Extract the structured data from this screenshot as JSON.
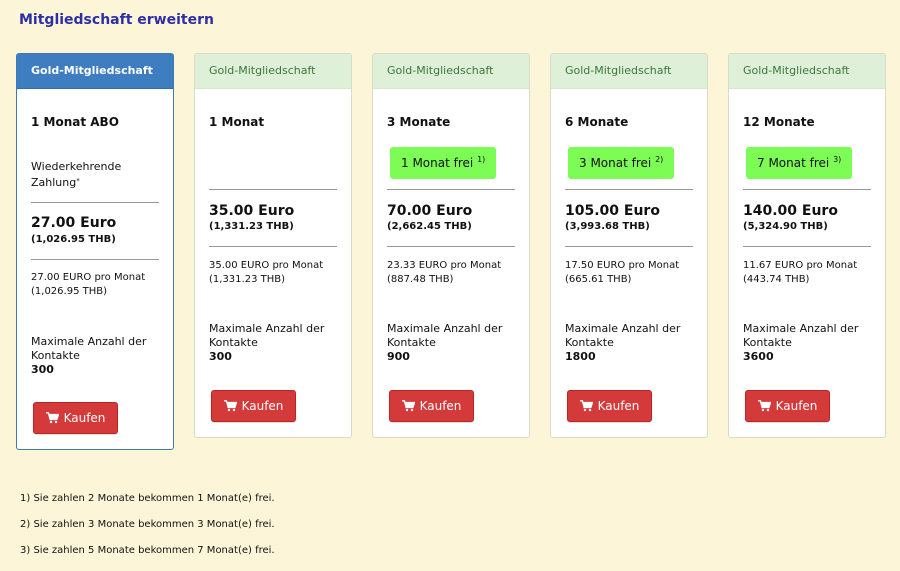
{
  "page": {
    "title": "Mitgliedschaft erweitern"
  },
  "plans": [
    {
      "header": "Gold-Mitgliedschaft",
      "name": "1 Monat ABO",
      "recurring_label": "Wiederkehrende Zahlung",
      "recurring_marker": "*",
      "price": "27.00 Euro",
      "price_thb": "(1,026.95 THB)",
      "monthly": "27.00 EURO pro Monat",
      "monthly_thb": "(1,026.95 THB)",
      "contacts_label": "Maximale Anzahl der Kontakte",
      "contacts": "300",
      "button": "Kaufen"
    },
    {
      "header": "Gold-Mitgliedschaft",
      "name": "1 Monat",
      "price": "35.00 Euro",
      "price_thb": "(1,331.23 THB)",
      "monthly": "35.00 EURO pro Monat",
      "monthly_thb": "(1,331.23 THB)",
      "contacts_label": "Maximale Anzahl der Kontakte",
      "contacts": "300",
      "button": "Kaufen"
    },
    {
      "header": "Gold-Mitgliedschaft",
      "name": "3 Monate",
      "free_label": "1 Monat frei",
      "free_ref": "1)",
      "price": "70.00 Euro",
      "price_thb": "(2,662.45 THB)",
      "monthly": "23.33 EURO pro Monat",
      "monthly_thb": "(887.48 THB)",
      "contacts_label": "Maximale Anzahl der Kontakte",
      "contacts": "900",
      "button": "Kaufen"
    },
    {
      "header": "Gold-Mitgliedschaft",
      "name": "6 Monate",
      "free_label": "3 Monat frei",
      "free_ref": "2)",
      "price": "105.00 Euro",
      "price_thb": "(3,993.68 THB)",
      "monthly": "17.50 EURO pro Monat",
      "monthly_thb": "(665.61 THB)",
      "contacts_label": "Maximale Anzahl der Kontakte",
      "contacts": "1800",
      "button": "Kaufen"
    },
    {
      "header": "Gold-Mitgliedschaft",
      "name": "12 Monate",
      "free_label": "7 Monat frei",
      "free_ref": "3)",
      "price": "140.00 Euro",
      "price_thb": "(5,324.90 THB)",
      "monthly": "11.67 EURO pro Monat",
      "monthly_thb": "(443.74 THB)",
      "contacts_label": "Maximale Anzahl der Kontakte",
      "contacts": "3600",
      "button": "Kaufen"
    }
  ],
  "footnotes": [
    "1) Sie zahlen 2 Monate bekommen 1 Monat(e) frei.",
    "2) Sie zahlen 3 Monate bekommen 3 Monat(e) frei.",
    "3) Sie zahlen 5 Monate bekommen 7 Monat(e) frei."
  ],
  "colors": {
    "background": "#fdf5d8",
    "title": "#2d2fa8",
    "featured_header": "#3f7dc1",
    "standard_header": "#dff0d8",
    "free_badge": "#7cfc55",
    "buy_button": "#d53a3a"
  },
  "icons": {
    "buy": "shopping-cart-icon"
  }
}
